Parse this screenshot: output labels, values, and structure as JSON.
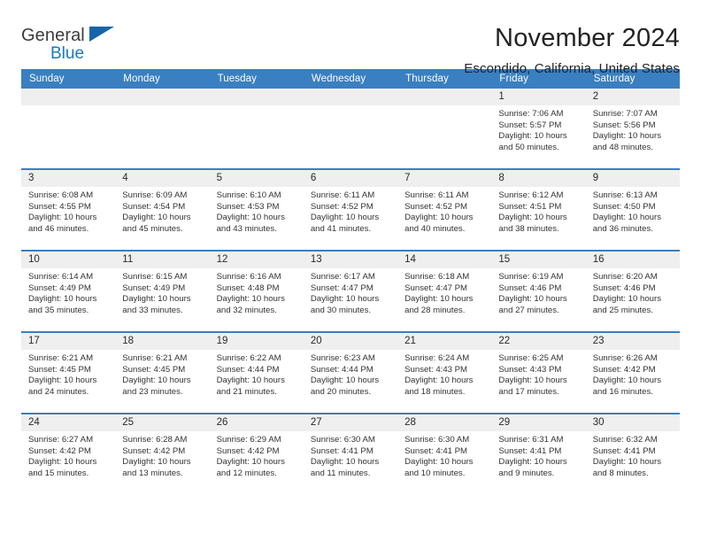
{
  "brand": {
    "line1": "General",
    "line2": "Blue",
    "logo_icon": "triangle-flag-icon"
  },
  "header": {
    "title": "November 2024",
    "subtitle": "Escondido, California, United States"
  },
  "calendar": {
    "day_headers": [
      "Sunday",
      "Monday",
      "Tuesday",
      "Wednesday",
      "Thursday",
      "Friday",
      "Saturday"
    ],
    "colors": {
      "header_blue": "#3a7fc1",
      "daynum_band": "#efefef",
      "brand_blue": "#1b78c2",
      "text": "#333333"
    },
    "labels": {
      "sunrise": "Sunrise:",
      "sunset": "Sunset:",
      "daylight": "Daylight:"
    },
    "weeks": [
      [
        {
          "empty": true
        },
        {
          "empty": true
        },
        {
          "empty": true
        },
        {
          "empty": true
        },
        {
          "empty": true
        },
        {
          "day": "1",
          "l1": "Sunrise: 7:06 AM",
          "l2": "Sunset: 5:57 PM",
          "l3": "Daylight: 10 hours",
          "l4": "and 50 minutes."
        },
        {
          "day": "2",
          "l1": "Sunrise: 7:07 AM",
          "l2": "Sunset: 5:56 PM",
          "l3": "Daylight: 10 hours",
          "l4": "and 48 minutes."
        }
      ],
      [
        {
          "day": "3",
          "l1": "Sunrise: 6:08 AM",
          "l2": "Sunset: 4:55 PM",
          "l3": "Daylight: 10 hours",
          "l4": "and 46 minutes."
        },
        {
          "day": "4",
          "l1": "Sunrise: 6:09 AM",
          "l2": "Sunset: 4:54 PM",
          "l3": "Daylight: 10 hours",
          "l4": "and 45 minutes."
        },
        {
          "day": "5",
          "l1": "Sunrise: 6:10 AM",
          "l2": "Sunset: 4:53 PM",
          "l3": "Daylight: 10 hours",
          "l4": "and 43 minutes."
        },
        {
          "day": "6",
          "l1": "Sunrise: 6:11 AM",
          "l2": "Sunset: 4:52 PM",
          "l3": "Daylight: 10 hours",
          "l4": "and 41 minutes."
        },
        {
          "day": "7",
          "l1": "Sunrise: 6:11 AM",
          "l2": "Sunset: 4:52 PM",
          "l3": "Daylight: 10 hours",
          "l4": "and 40 minutes."
        },
        {
          "day": "8",
          "l1": "Sunrise: 6:12 AM",
          "l2": "Sunset: 4:51 PM",
          "l3": "Daylight: 10 hours",
          "l4": "and 38 minutes."
        },
        {
          "day": "9",
          "l1": "Sunrise: 6:13 AM",
          "l2": "Sunset: 4:50 PM",
          "l3": "Daylight: 10 hours",
          "l4": "and 36 minutes."
        }
      ],
      [
        {
          "day": "10",
          "l1": "Sunrise: 6:14 AM",
          "l2": "Sunset: 4:49 PM",
          "l3": "Daylight: 10 hours",
          "l4": "and 35 minutes."
        },
        {
          "day": "11",
          "l1": "Sunrise: 6:15 AM",
          "l2": "Sunset: 4:49 PM",
          "l3": "Daylight: 10 hours",
          "l4": "and 33 minutes."
        },
        {
          "day": "12",
          "l1": "Sunrise: 6:16 AM",
          "l2": "Sunset: 4:48 PM",
          "l3": "Daylight: 10 hours",
          "l4": "and 32 minutes."
        },
        {
          "day": "13",
          "l1": "Sunrise: 6:17 AM",
          "l2": "Sunset: 4:47 PM",
          "l3": "Daylight: 10 hours",
          "l4": "and 30 minutes."
        },
        {
          "day": "14",
          "l1": "Sunrise: 6:18 AM",
          "l2": "Sunset: 4:47 PM",
          "l3": "Daylight: 10 hours",
          "l4": "and 28 minutes."
        },
        {
          "day": "15",
          "l1": "Sunrise: 6:19 AM",
          "l2": "Sunset: 4:46 PM",
          "l3": "Daylight: 10 hours",
          "l4": "and 27 minutes."
        },
        {
          "day": "16",
          "l1": "Sunrise: 6:20 AM",
          "l2": "Sunset: 4:46 PM",
          "l3": "Daylight: 10 hours",
          "l4": "and 25 minutes."
        }
      ],
      [
        {
          "day": "17",
          "l1": "Sunrise: 6:21 AM",
          "l2": "Sunset: 4:45 PM",
          "l3": "Daylight: 10 hours",
          "l4": "and 24 minutes."
        },
        {
          "day": "18",
          "l1": "Sunrise: 6:21 AM",
          "l2": "Sunset: 4:45 PM",
          "l3": "Daylight: 10 hours",
          "l4": "and 23 minutes."
        },
        {
          "day": "19",
          "l1": "Sunrise: 6:22 AM",
          "l2": "Sunset: 4:44 PM",
          "l3": "Daylight: 10 hours",
          "l4": "and 21 minutes."
        },
        {
          "day": "20",
          "l1": "Sunrise: 6:23 AM",
          "l2": "Sunset: 4:44 PM",
          "l3": "Daylight: 10 hours",
          "l4": "and 20 minutes."
        },
        {
          "day": "21",
          "l1": "Sunrise: 6:24 AM",
          "l2": "Sunset: 4:43 PM",
          "l3": "Daylight: 10 hours",
          "l4": "and 18 minutes."
        },
        {
          "day": "22",
          "l1": "Sunrise: 6:25 AM",
          "l2": "Sunset: 4:43 PM",
          "l3": "Daylight: 10 hours",
          "l4": "and 17 minutes."
        },
        {
          "day": "23",
          "l1": "Sunrise: 6:26 AM",
          "l2": "Sunset: 4:42 PM",
          "l3": "Daylight: 10 hours",
          "l4": "and 16 minutes."
        }
      ],
      [
        {
          "day": "24",
          "l1": "Sunrise: 6:27 AM",
          "l2": "Sunset: 4:42 PM",
          "l3": "Daylight: 10 hours",
          "l4": "and 15 minutes."
        },
        {
          "day": "25",
          "l1": "Sunrise: 6:28 AM",
          "l2": "Sunset: 4:42 PM",
          "l3": "Daylight: 10 hours",
          "l4": "and 13 minutes."
        },
        {
          "day": "26",
          "l1": "Sunrise: 6:29 AM",
          "l2": "Sunset: 4:42 PM",
          "l3": "Daylight: 10 hours",
          "l4": "and 12 minutes."
        },
        {
          "day": "27",
          "l1": "Sunrise: 6:30 AM",
          "l2": "Sunset: 4:41 PM",
          "l3": "Daylight: 10 hours",
          "l4": "and 11 minutes."
        },
        {
          "day": "28",
          "l1": "Sunrise: 6:30 AM",
          "l2": "Sunset: 4:41 PM",
          "l3": "Daylight: 10 hours",
          "l4": "and 10 minutes."
        },
        {
          "day": "29",
          "l1": "Sunrise: 6:31 AM",
          "l2": "Sunset: 4:41 PM",
          "l3": "Daylight: 10 hours",
          "l4": "and 9 minutes."
        },
        {
          "day": "30",
          "l1": "Sunrise: 6:32 AM",
          "l2": "Sunset: 4:41 PM",
          "l3": "Daylight: 10 hours",
          "l4": "and 8 minutes."
        }
      ]
    ]
  }
}
